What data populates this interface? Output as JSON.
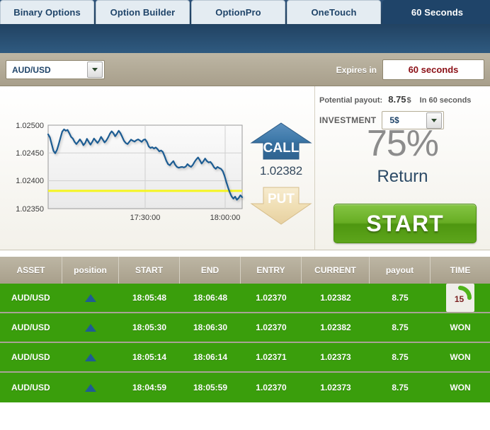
{
  "tabs": [
    {
      "label": "Binary Options",
      "active": false
    },
    {
      "label": "Option Builder",
      "active": false
    },
    {
      "label": "OptionPro",
      "active": false
    },
    {
      "label": "OneTouch",
      "active": false
    },
    {
      "label": "60 Seconds",
      "active": true
    }
  ],
  "toolbar": {
    "asset": "AUD/USD",
    "expires_label": "Expires in",
    "expires_value": "60 seconds"
  },
  "chart_data": {
    "type": "line",
    "title": "",
    "xlabel": "",
    "ylabel": "",
    "ylim": [
      1.0235,
      1.025
    ],
    "ytick_labels": [
      "1.02500",
      "1.02450",
      "1.02400",
      "1.02350"
    ],
    "yticks": [
      1.025,
      1.0245,
      1.024,
      1.0235
    ],
    "xtick_labels": [
      "17:30:00",
      "18:00:00"
    ],
    "grid": true,
    "legend": "none",
    "line_color": "#1f5c92",
    "strike_line_color": "#f5f520",
    "strike_value": 1.02382,
    "series": [
      {
        "name": "AUD/USD",
        "values": [
          1.024835,
          1.02478,
          1.02466,
          1.02454,
          1.024495,
          1.024555,
          1.02466,
          1.024775,
          1.024885,
          1.024925,
          1.0249,
          1.024915,
          1.024855,
          1.02479,
          1.02476,
          1.0247,
          1.02466,
          1.0247,
          1.024745,
          1.0247,
          1.02464,
          1.02468,
          1.024755,
          1.0247,
          1.02465,
          1.0247,
          1.02476,
          1.02472,
          1.02468,
          1.024725,
          1.02479,
          1.02474,
          1.02469,
          1.024725,
          1.02478,
          1.024845,
          1.02489,
          1.024855,
          1.0248,
          1.024845,
          1.0249,
          1.024855,
          1.02479,
          1.02472,
          1.02468,
          1.02466,
          1.0247,
          1.02474,
          1.02472,
          1.024705,
          1.02473,
          1.024745,
          1.024725,
          1.0247,
          1.024735,
          1.024745,
          1.0247,
          1.02462,
          1.02459,
          1.024605,
          1.02458,
          1.0246,
          1.02457,
          1.02453,
          1.024545,
          1.02452,
          1.024445,
          1.02436,
          1.0243,
          1.02428,
          1.02432,
          1.024355,
          1.02429,
          1.02425,
          1.024235,
          1.024245,
          1.02425,
          1.02424,
          1.024255,
          1.0243,
          1.02427,
          1.02425,
          1.024285,
          1.02434,
          1.024385,
          1.02442,
          1.02437,
          1.02431,
          1.02435,
          1.0244,
          1.024355,
          1.02433,
          1.02434,
          1.0243,
          1.024245,
          1.024215,
          1.02425,
          1.02423,
          1.024215,
          1.024175,
          1.02409,
          1.02398,
          1.02388,
          1.02379,
          1.02372,
          1.02368,
          1.023715,
          1.02366,
          1.02369,
          1.02374,
          1.023705
        ]
      }
    ]
  },
  "trade": {
    "call_label": "CALL",
    "put_label": "PUT",
    "current_price": "1.02382"
  },
  "panel": {
    "potential_payout_label": "Potential payout:",
    "potential_payout_value": "8.75",
    "potential_payout_currency": "$",
    "in_seconds_label": "In 60 seconds",
    "investment_label": "INVESTMENT",
    "investment_value": "5$",
    "return_percent": "75%",
    "return_label": "Return",
    "start_label": "START"
  },
  "table": {
    "headers": [
      "ASSET",
      "position",
      "START",
      "END",
      "ENTRY",
      "CURRENT",
      "payout",
      "TIME"
    ],
    "rows": [
      {
        "asset": "AUD/USD",
        "position": "up",
        "start": "18:05:48",
        "end": "18:06:48",
        "entry": "1.02370",
        "current": "1.02382",
        "payout": "8.75",
        "time": "15",
        "time_type": "timer"
      },
      {
        "asset": "AUD/USD",
        "position": "up",
        "start": "18:05:30",
        "end": "18:06:30",
        "entry": "1.02370",
        "current": "1.02382",
        "payout": "8.75",
        "time": "WON",
        "time_type": "status"
      },
      {
        "asset": "AUD/USD",
        "position": "up",
        "start": "18:05:14",
        "end": "18:06:14",
        "entry": "1.02371",
        "current": "1.02373",
        "payout": "8.75",
        "time": "WON",
        "time_type": "status"
      },
      {
        "asset": "AUD/USD",
        "position": "up",
        "start": "18:04:59",
        "end": "18:05:59",
        "entry": "1.02370",
        "current": "1.02373",
        "payout": "8.75",
        "time": "WON",
        "time_type": "status"
      }
    ]
  },
  "colors": {
    "tab_active_bg": "#1f4469",
    "tab_inactive_bg": "#e4ecf2",
    "toolbar_bg": "#a89f8b",
    "row_green": "#3a9e0c",
    "start_green": "#67ad23",
    "expires_red": "#8b0f16",
    "call_blue": "#3a6f9f",
    "put_tan": "#f0dfb5"
  }
}
